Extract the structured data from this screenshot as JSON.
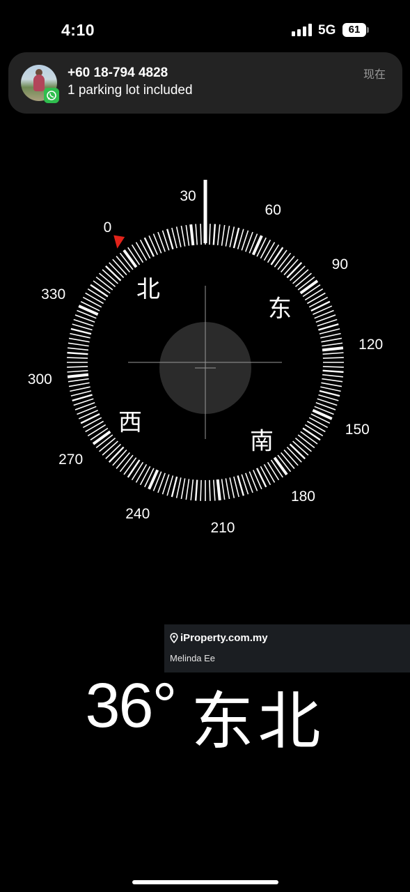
{
  "status_bar": {
    "time": "4:10",
    "network": "5G",
    "battery": "61"
  },
  "notification": {
    "app_icon": "whatsapp-icon",
    "title": "+60 18-794 4828",
    "body": "1 parking lot included",
    "time": "现在"
  },
  "compass": {
    "heading_degrees": 36,
    "degree_labels": [
      "0",
      "30",
      "60",
      "90",
      "120",
      "150",
      "180",
      "210",
      "240",
      "270",
      "300",
      "330"
    ],
    "cardinals": {
      "north": "北",
      "east": "东",
      "south": "南",
      "west": "西"
    },
    "marker_color": "#e2231a"
  },
  "watermark": {
    "logo": "iProperty.com.my",
    "agent": "Melinda Ee"
  },
  "heading_readout": {
    "degrees": "36°",
    "direction": "东北"
  }
}
